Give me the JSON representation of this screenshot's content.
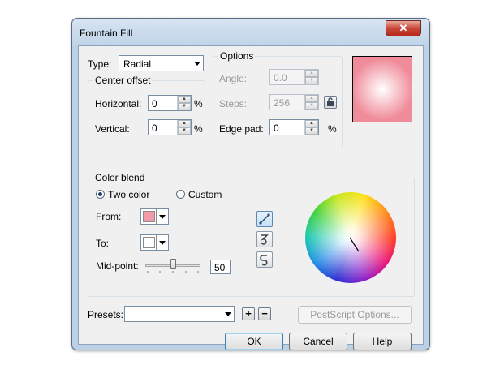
{
  "window": {
    "title": "Fountain Fill",
    "close_label": "✕"
  },
  "type": {
    "label": "Type:",
    "value": "Radial"
  },
  "center_offset": {
    "title": "Center offset",
    "horizontal_label": "Horizontal:",
    "horizontal_value": "0",
    "vertical_label": "Vertical:",
    "vertical_value": "0",
    "unit": "%"
  },
  "options": {
    "title": "Options",
    "angle_label": "Angle:",
    "angle_value": "0.0",
    "steps_label": "Steps:",
    "steps_value": "256",
    "edge_pad_label": "Edge pad:",
    "edge_pad_value": "0",
    "unit": "%"
  },
  "preview": {
    "center_color": "#ffffff",
    "edge_color": "#f08c9a"
  },
  "color_blend": {
    "title": "Color blend",
    "two_color_label": "Two color",
    "custom_label": "Custom",
    "selected": "two_color",
    "from_label": "From:",
    "from_color": "#f29aa6",
    "to_label": "To:",
    "to_color": "#ffffff",
    "midpoint_label": "Mid-point:",
    "midpoint_value": "50",
    "midpoint_fraction": 0.5
  },
  "presets": {
    "label": "Presets:",
    "value": ""
  },
  "buttons": {
    "postscript": "PostScript Options...",
    "ok": "OK",
    "cancel": "Cancel",
    "help": "Help",
    "add_symbol": "+",
    "remove_symbol": "−"
  },
  "colors": {
    "accent": "#3c7fb1",
    "titlebar": "#c9d9ea",
    "close": "#c9473a"
  }
}
